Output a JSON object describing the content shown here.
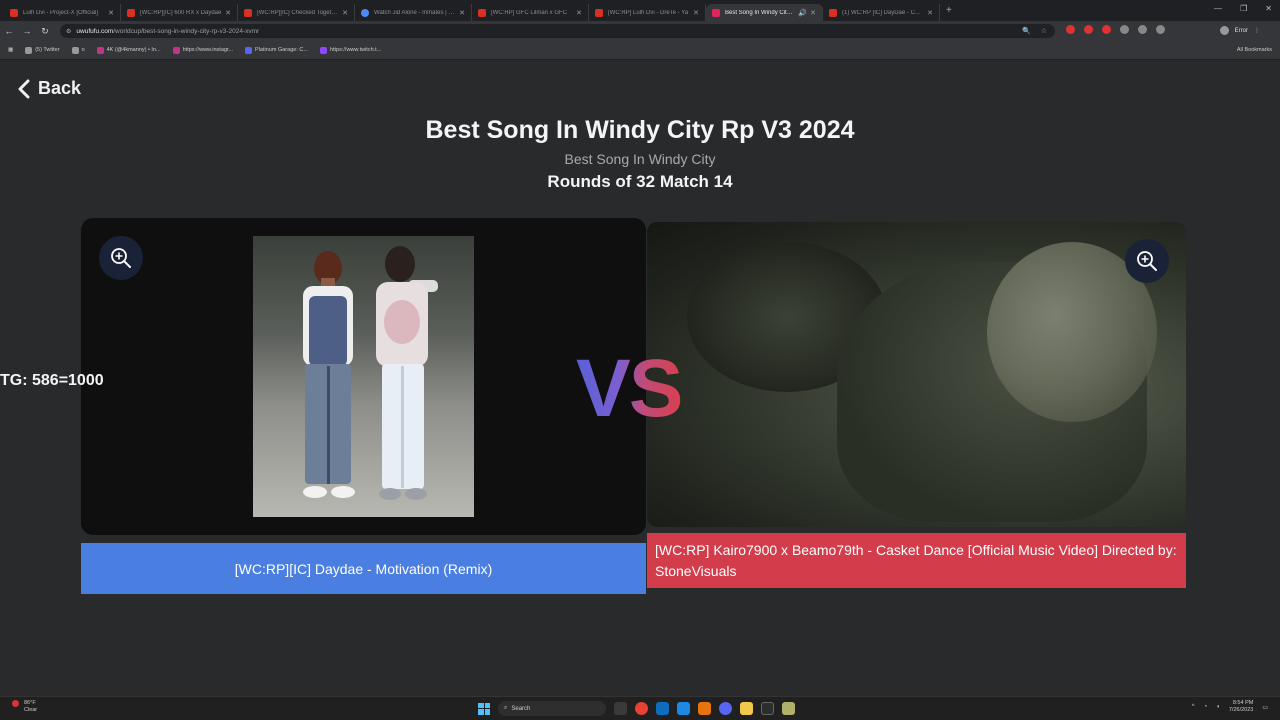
{
  "browser": {
    "tabs": [
      {
        "title": "Lulh Dvi - Project-X [Official]",
        "icon": "youtube-icon"
      },
      {
        "title": "[WC:RP][IC] 600 RX x Daydae",
        "icon": "youtube-icon"
      },
      {
        "title": "[WC:RP][IC] Checked Together",
        "icon": "youtube-icon"
      },
      {
        "title": "Watch Jid Alone - Inmates | Sho",
        "icon": "globe-icon"
      },
      {
        "title": "[WC:RP] GFC Lilman x GFC",
        "icon": "youtube-icon"
      },
      {
        "title": "[WC:RP] Lulh Dvi - DreTe - Ya",
        "icon": "youtube-icon"
      },
      {
        "title": "Best Song In Windy City Rp",
        "icon": "uwufufu-icon",
        "active": true
      },
      {
        "title": "(1) WC:RP [IC] DayDae - Comp",
        "icon": "youtube-icon"
      }
    ],
    "url_host": "uwufufu.com",
    "url_path": "/worldcup/best-song-in-windy-city-rp-v3-2024-xvmr",
    "profile_label": "Error",
    "bookmarks": [
      {
        "label": "(5) Twitter",
        "icon": "x-icon"
      },
      {
        "label": "o",
        "icon": "bookmark-icon"
      },
      {
        "label": "4K (@4kmanny) • In...",
        "icon": "instagram-icon"
      },
      {
        "label": "https://www.instagr...",
        "icon": "instagram-icon"
      },
      {
        "label": "Platinum Garage: C...",
        "icon": "bookmark-icon"
      },
      {
        "label": "https://www.twitch.t...",
        "icon": "twitch-icon"
      }
    ],
    "all_bookmarks": "All Bookmarks"
  },
  "page": {
    "back_label": "Back",
    "title": "Best Song In Windy City Rp V3 2024",
    "subtitle": "Best Song In Windy City",
    "round": "Rounds of 32 Match 14",
    "overlay_text": "TG: 586=1000",
    "vs_text": "VS",
    "left_choice": "[WC:RP][IC] Daydae - Motivation (Remix)",
    "right_choice": "[WC:RP] Kairo7900 x Beamo79th - Casket Dance [Official Music Video] Directed by: StoneVisuals"
  },
  "taskbar": {
    "temperature": "86°F",
    "weather": "Clear",
    "search_placeholder": "Search",
    "time": "8:54 PM",
    "date": "7/26/2023"
  },
  "colors": {
    "left_label": "#4a7ee0",
    "right_label": "#d23c4b",
    "background": "#292a2c"
  }
}
